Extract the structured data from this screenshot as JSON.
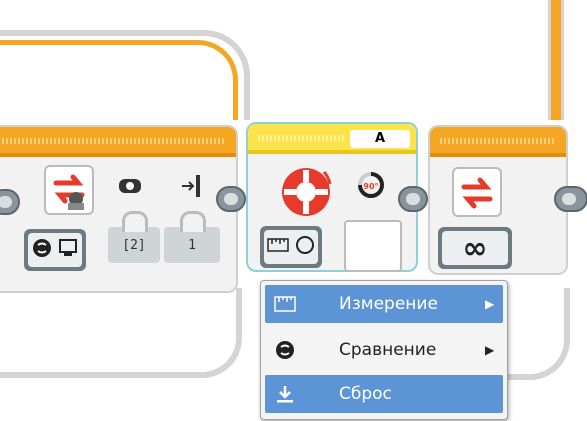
{
  "colors": {
    "header": "#f5a623",
    "header_dark": "#e08e0b",
    "selected": "#5d94d6",
    "block_bg": "#f2f2f2",
    "plug": "#8a949c"
  },
  "block_left": {
    "params": [
      "[2]",
      "1"
    ],
    "icons": [
      "loop-interrupt-icon",
      "sensor-icon",
      "slider-icon",
      "compare-icon",
      "screen-icon"
    ]
  },
  "block_middle": {
    "port": "A",
    "icons": [
      "motor-rotation-icon",
      "rotation-90-icon",
      "ruler-icon",
      "degrees-icon"
    ],
    "rotation_label": "90°"
  },
  "block_right": {
    "mode_symbol": "∞",
    "icons": [
      "loop-icon"
    ]
  },
  "menu": {
    "items": [
      {
        "label": "Измерение",
        "icon": "measure-icon",
        "has_submenu": true,
        "arrow": "▶",
        "selected": true
      },
      {
        "label": "Сравнение",
        "icon": "compare-icon",
        "has_submenu": true,
        "arrow": "▶",
        "selected": false
      },
      {
        "label": "Сброс",
        "icon": "reset-icon",
        "has_submenu": false,
        "arrow": "",
        "selected": true
      }
    ]
  }
}
